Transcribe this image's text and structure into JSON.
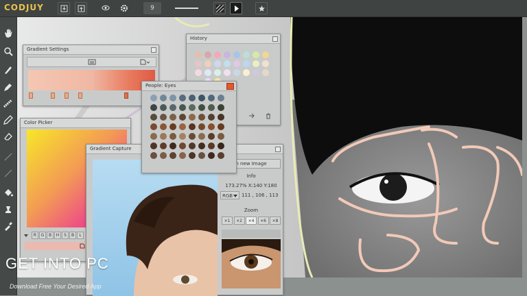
{
  "app": {
    "logo_main": "COD",
    "logo_accent": "JUY",
    "brush_size": "9"
  },
  "panels": {
    "gradient_settings": {
      "title": "Gradient Settings"
    },
    "history": {
      "title": "History"
    },
    "people_eyes": {
      "title": "People: Eyes"
    },
    "color_picker": {
      "title": "Color Picker",
      "channels": [
        "R",
        "G",
        "B",
        "H",
        "S",
        "B",
        "L"
      ]
    },
    "gradient_capture": {
      "title": "Gradient Capture",
      "open_button": "n new Image",
      "info_label": "Info",
      "zoom_readout": "173.27% X:140 Y:180",
      "mode": "RGB",
      "rgb_values": "111 , 106 , 113",
      "zoom_label": "Zoom",
      "zoom_options": [
        "×1",
        "×2",
        "×4",
        "×6",
        "×8"
      ]
    }
  },
  "colors": {
    "history_swatches": [
      "#e3bfae",
      "#d8a8a6",
      "#f4a7b9",
      "#c8b5e0",
      "#a8c4e8",
      "#b8e0d8",
      "#d8e8a8",
      "#f0d890",
      "#e8c4c4",
      "#f0d0b8",
      "#d0d8f0",
      "#c0e0f0",
      "#e0c8e8",
      "#b8d8f8",
      "#e8f0c0",
      "#f4e0d0",
      "#f8d8e0",
      "#e0e8f8",
      "#d8f0e8",
      "#f0e0f0",
      "#c8d8e8",
      "#f8f0d0",
      "#d0c8e0",
      "#e8d8c8",
      "#c0d0c8",
      "#e8e0f0",
      "#f8e8a0"
    ],
    "eye_swatches": [
      "#8aa0b4",
      "#6f8799",
      "#7c94a8",
      "#566c80",
      "#4a6074",
      "#3c5468",
      "#52687a",
      "#6a8092",
      "#3e4644",
      "#4a5a58",
      "#58676a",
      "#465850",
      "#5a6a5e",
      "#40503f",
      "#4f5d4a",
      "#3a4232",
      "#5a4a3a",
      "#6a5544",
      "#7a6046",
      "#5e4632",
      "#8a6a48",
      "#6e5034",
      "#544030",
      "#483424",
      "#7a4a2e",
      "#8c5636",
      "#6c3c22",
      "#9a6440",
      "#5a3420",
      "#744828",
      "#884e2e",
      "#6a3a1e",
      "#8a6a50",
      "#9a7858",
      "#7a5a40",
      "#a88060",
      "#6a4a34",
      "#8c6a4c",
      "#5a3c28",
      "#7c5a3e",
      "#4e3426",
      "#603c2a",
      "#3e2a1e",
      "#70482e",
      "#52362a",
      "#442c20",
      "#5a3826",
      "#3a261a",
      "#6a5040",
      "#7a5c48",
      "#5c4434",
      "#86644c",
      "#4a3428",
      "#685040",
      "#3c2a20",
      "#58402e"
    ]
  }
}
